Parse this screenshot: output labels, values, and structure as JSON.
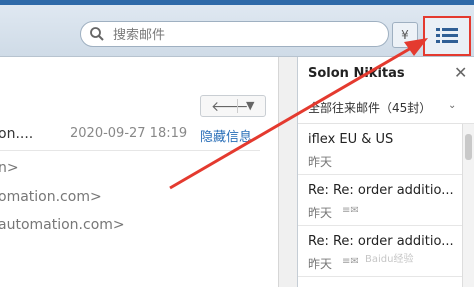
{
  "search": {
    "placeholder": "搜索邮件"
  },
  "toolbar": {
    "filter_icon": "chevron-down-double",
    "list_icon": "list-icon"
  },
  "message": {
    "sender": "on....",
    "date": "2020-09-27 18:19",
    "hide_link": "隐藏信息",
    "lines": [
      "n>",
      "omation.com>",
      "automation.com>"
    ]
  },
  "sidepanel": {
    "title": "Solon Nikitas",
    "filter": "全部往来邮件（45封）",
    "mails": [
      {
        "subject": "iflex EU & US",
        "date": "昨天"
      },
      {
        "subject": "Re: Re: order additio...",
        "date": "昨天"
      },
      {
        "subject": "Re: Re: order additio...",
        "date": "昨天"
      }
    ]
  },
  "watermark": "Baidu经验",
  "colors": {
    "accent": "#e43a2f",
    "link": "#2a6fb8",
    "toolbar": "#d8e2ec"
  }
}
